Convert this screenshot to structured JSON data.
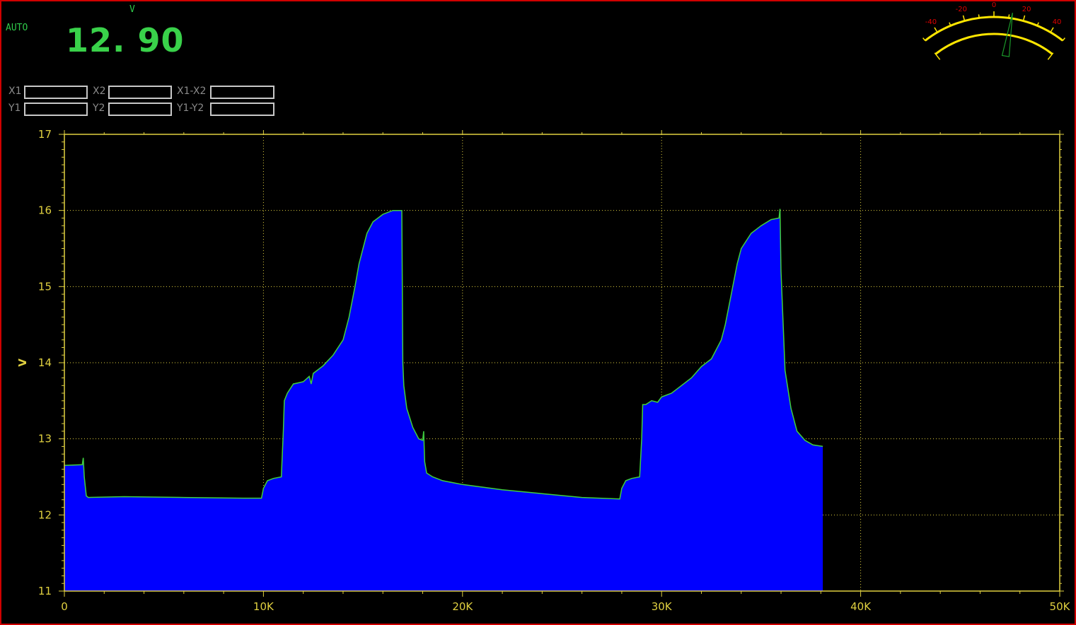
{
  "header": {
    "mode": "AUTO",
    "unit": "V",
    "reading": "12. 90"
  },
  "cursors": [
    {
      "label": "X1",
      "value": ""
    },
    {
      "label": "X2",
      "value": ""
    },
    {
      "label": "X1-X2",
      "value": ""
    },
    {
      "label": "Y1",
      "value": ""
    },
    {
      "label": "Y2",
      "value": ""
    },
    {
      "label": "Y1-Y2",
      "value": ""
    }
  ],
  "gauge": {
    "ticks": [
      "-40",
      "-20",
      "0",
      "20",
      "40"
    ],
    "tick_values": [
      -40,
      -20,
      0,
      20,
      40
    ],
    "range": [
      -50,
      50
    ],
    "needle_value": 12,
    "color": "#ffe600",
    "tick_color": "#e00000",
    "needle_color": "#1b9a2a"
  },
  "chart_data": {
    "type": "area",
    "ylabel": "V",
    "xlim": [
      0,
      50000
    ],
    "ylim": [
      11,
      17
    ],
    "x_ticks": [
      0,
      10000,
      20000,
      30000,
      40000,
      50000
    ],
    "x_tick_labels": [
      "0",
      "10K",
      "20K",
      "30K",
      "40K",
      "50K"
    ],
    "y_ticks": [
      11,
      12,
      13,
      14,
      15,
      16,
      17
    ],
    "y_tick_labels": [
      "11",
      "12",
      "13",
      "14",
      "15",
      "16",
      "17"
    ],
    "grid": true,
    "fill_color": "#0000ff",
    "line_color": "#3fcf3f",
    "axis_color": "#e0d040",
    "series": [
      {
        "x": [
          0,
          900,
          950,
          1000,
          1100,
          1200,
          3000,
          6000,
          9000,
          9900,
          10000,
          10200,
          10500,
          10900,
          11000,
          11050,
          11200,
          11500,
          12000,
          12300,
          12400,
          12500,
          13000,
          13500,
          14000,
          14300,
          14600,
          14800,
          15000,
          15200,
          15500,
          16000,
          16500,
          16950,
          17000,
          17050,
          17200,
          17500,
          17800,
          18000,
          18050,
          18100,
          18200,
          18500,
          19000,
          20000,
          22000,
          24000,
          26000,
          27900,
          28000,
          28200,
          28500,
          28900,
          29000,
          29050,
          29200,
          29500,
          29800,
          30000,
          30500,
          31000,
          31500,
          32000,
          32500,
          33000,
          33200,
          33500,
          33800,
          34000,
          34500,
          35000,
          35500,
          35900,
          35950,
          36000,
          36200,
          36500,
          36800,
          37200,
          37600,
          38100
        ],
        "values": [
          12.65,
          12.66,
          12.75,
          12.5,
          12.25,
          12.23,
          12.24,
          12.23,
          12.22,
          12.22,
          12.35,
          12.45,
          12.48,
          12.5,
          13.1,
          13.5,
          13.6,
          13.72,
          13.75,
          13.82,
          13.72,
          13.86,
          13.96,
          14.1,
          14.3,
          14.6,
          15.0,
          15.3,
          15.5,
          15.7,
          15.85,
          15.95,
          16.0,
          16.0,
          14.0,
          13.7,
          13.4,
          13.15,
          13.0,
          12.98,
          13.1,
          12.7,
          12.55,
          12.5,
          12.45,
          12.4,
          12.33,
          12.28,
          12.23,
          12.21,
          12.35,
          12.45,
          12.48,
          12.5,
          13.0,
          13.45,
          13.45,
          13.5,
          13.48,
          13.55,
          13.6,
          13.7,
          13.8,
          13.95,
          14.05,
          14.3,
          14.5,
          14.9,
          15.3,
          15.5,
          15.7,
          15.8,
          15.88,
          15.9,
          16.02,
          15.2,
          13.9,
          13.4,
          13.1,
          12.98,
          12.92,
          12.9
        ]
      }
    ]
  }
}
